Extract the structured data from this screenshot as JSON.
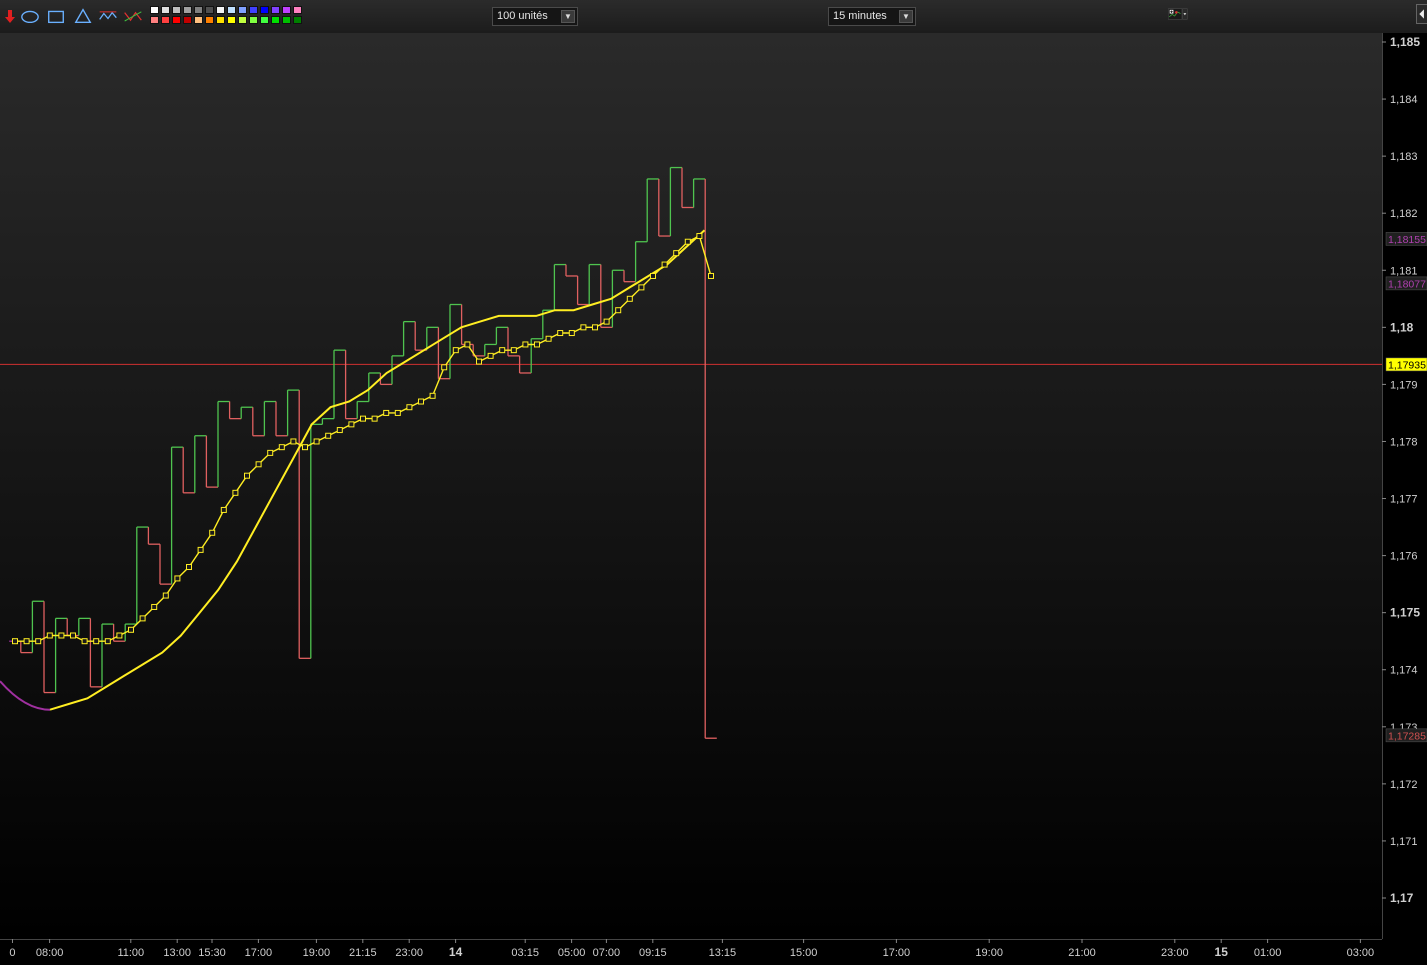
{
  "toolbar": {
    "units_select": "100 unités",
    "timeframe_select": "15 minutes",
    "tool_icons": [
      "arrow-down-icon",
      "ellipse-tool-icon",
      "rectangle-tool-icon",
      "triangle-tool-icon",
      "wave-tool-icon",
      "pattern-tool-icon"
    ],
    "palette": [
      "#ffffff",
      "#e0e0e0",
      "#c0c0c0",
      "#a0a0a0",
      "#808080",
      "#505050",
      "#f4f4f4",
      "#c0e0ff",
      "#80a0ff",
      "#4040ff",
      "#0000ff",
      "#8040ff",
      "#c040ff",
      "#ff80c0",
      "#ff8080",
      "#ff4040",
      "#ff0000",
      "#c00000",
      "#ffc080",
      "#ff8000",
      "#ffe000",
      "#ffff00",
      "#c0ff40",
      "#80ff40",
      "#40ff40",
      "#00e000",
      "#00c000",
      "#008000"
    ]
  },
  "chart_data": {
    "type": "line",
    "title": "",
    "xlabel": "",
    "ylabel": "",
    "ylim": [
      1.1695,
      1.1852
    ],
    "y_ticks": [
      {
        "value": 1.185,
        "label": "1,185",
        "bold": true
      },
      {
        "value": 1.184,
        "label": "1,184",
        "bold": false
      },
      {
        "value": 1.183,
        "label": "1,183",
        "bold": false
      },
      {
        "value": 1.182,
        "label": "1,182",
        "bold": false
      },
      {
        "value": 1.181,
        "label": "1,181",
        "bold": false
      },
      {
        "value": 1.18,
        "label": "1,18",
        "bold": true
      },
      {
        "value": 1.179,
        "label": "1,179",
        "bold": false
      },
      {
        "value": 1.178,
        "label": "1,178",
        "bold": false
      },
      {
        "value": 1.177,
        "label": "1,177",
        "bold": false
      },
      {
        "value": 1.176,
        "label": "1,176",
        "bold": false
      },
      {
        "value": 1.175,
        "label": "1,175",
        "bold": true
      },
      {
        "value": 1.174,
        "label": "1,174",
        "bold": false
      },
      {
        "value": 1.173,
        "label": "1,173",
        "bold": false
      },
      {
        "value": 1.172,
        "label": "1,172",
        "bold": false
      },
      {
        "value": 1.171,
        "label": "1,171",
        "bold": false
      },
      {
        "value": 1.17,
        "label": "1,17",
        "bold": true
      }
    ],
    "x_ticks": [
      {
        "index": -2.2,
        "label": "0",
        "bold": false
      },
      {
        "index": 1,
        "label": "08:00",
        "bold": false
      },
      {
        "index": 8,
        "label": "11:00",
        "bold": false
      },
      {
        "index": 12,
        "label": "13:00",
        "bold": false
      },
      {
        "index": 15,
        "label": "15:30",
        "bold": false
      },
      {
        "index": 19,
        "label": "17:00",
        "bold": false
      },
      {
        "index": 24,
        "label": "19:00",
        "bold": false
      },
      {
        "index": 28,
        "label": "21:15",
        "bold": false
      },
      {
        "index": 32,
        "label": "23:00",
        "bold": false
      },
      {
        "index": 36,
        "label": "14",
        "bold": true
      },
      {
        "index": 42,
        "label": "03:15",
        "bold": false
      },
      {
        "index": 46,
        "label": "05:00",
        "bold": false
      },
      {
        "index": 49,
        "label": "07:00",
        "bold": false
      },
      {
        "index": 53,
        "label": "09:15",
        "bold": false
      },
      {
        "index": 59,
        "label": "13:15",
        "bold": false
      },
      {
        "index": 66,
        "label": "15:00",
        "bold": false
      },
      {
        "index": 74,
        "label": "17:00",
        "bold": false
      },
      {
        "index": 82,
        "label": "19:00",
        "bold": false
      },
      {
        "index": 90,
        "label": "21:00",
        "bold": false
      },
      {
        "index": 98,
        "label": "23:00",
        "bold": false
      },
      {
        "index": 102,
        "label": "15",
        "bold": true
      },
      {
        "index": 106,
        "label": "01:00",
        "bold": false
      },
      {
        "index": 114,
        "label": "03:00",
        "bold": false
      }
    ],
    "price_closes": [
      1.1745,
      1.1743,
      1.1752,
      1.1736,
      1.1749,
      1.1746,
      1.1749,
      1.1737,
      1.1748,
      1.1745,
      1.1748,
      1.1765,
      1.1762,
      1.1755,
      1.1779,
      1.1771,
      1.1781,
      1.1772,
      1.1787,
      1.1784,
      1.1786,
      1.1781,
      1.1787,
      1.1781,
      1.1789,
      1.1742,
      1.1783,
      1.1784,
      1.1796,
      1.1784,
      1.1787,
      1.1792,
      1.179,
      1.1795,
      1.1801,
      1.1796,
      1.18,
      1.1791,
      1.1804,
      1.1797,
      1.1795,
      1.1797,
      1.18,
      1.1795,
      1.1792,
      1.1798,
      1.1803,
      1.1811,
      1.1809,
      1.1804,
      1.1811,
      1.18,
      1.181,
      1.1808,
      1.1815,
      1.1826,
      1.1816,
      1.1828,
      1.1821,
      1.1826,
      1.1728
    ],
    "series": [
      {
        "color": "#ffee22",
        "markers": false,
        "values": [
          1.1733,
          1.1734,
          1.1735,
          1.1737,
          1.1739,
          1.1741,
          1.1743,
          1.1746,
          1.175,
          1.1754,
          1.1759,
          1.1765,
          1.1771,
          1.1777,
          1.1783,
          1.1786,
          1.1787,
          1.1789,
          1.1792,
          1.1794,
          1.1796,
          1.1798,
          1.18,
          1.1801,
          1.1802,
          1.1802,
          1.1802,
          1.1803,
          1.1803,
          1.1804,
          1.1805,
          1.1807,
          1.1809,
          1.1811,
          1.1814,
          1.1817
        ]
      },
      {
        "color": "#ffee22",
        "markers": true,
        "values": [
          1.1745,
          1.1745,
          1.1745,
          1.1746,
          1.1746,
          1.1746,
          1.1745,
          1.1745,
          1.1745,
          1.1746,
          1.1747,
          1.1749,
          1.1751,
          1.1753,
          1.1756,
          1.1758,
          1.1761,
          1.1764,
          1.1768,
          1.1771,
          1.1774,
          1.1776,
          1.1778,
          1.1779,
          1.178,
          1.1779,
          1.178,
          1.1781,
          1.1782,
          1.1783,
          1.1784,
          1.1784,
          1.1785,
          1.1785,
          1.1786,
          1.1787,
          1.1788,
          1.1793,
          1.1796,
          1.1797,
          1.1794,
          1.1795,
          1.1796,
          1.1796,
          1.1797,
          1.1797,
          1.1798,
          1.1799,
          1.1799,
          1.18,
          1.18,
          1.1801,
          1.1803,
          1.1805,
          1.1807,
          1.1809,
          1.1811,
          1.1813,
          1.1815,
          1.1816,
          1.1809
        ]
      }
    ],
    "horizontal_line": {
      "value": 1.17935,
      "color": "#d03030"
    },
    "price_labels": [
      {
        "value": 1.17935,
        "label": "1,17935",
        "bg": "#ffff00",
        "fg": "#000000"
      },
      {
        "value": 1.18155,
        "label": "1,18155",
        "bg": "#202020",
        "fg": "#b040b0"
      },
      {
        "value": 1.18077,
        "label": "1,18077",
        "bg": "#202020",
        "fg": "#b040b0"
      },
      {
        "value": 1.17285,
        "label": "1,17285",
        "bg": "#202020",
        "fg": "#d05050"
      }
    ],
    "colors": {
      "up": "#4fc44f",
      "down": "#e06060",
      "neutral": "#a030a0",
      "ma": "#ffee22"
    },
    "grid": false
  }
}
